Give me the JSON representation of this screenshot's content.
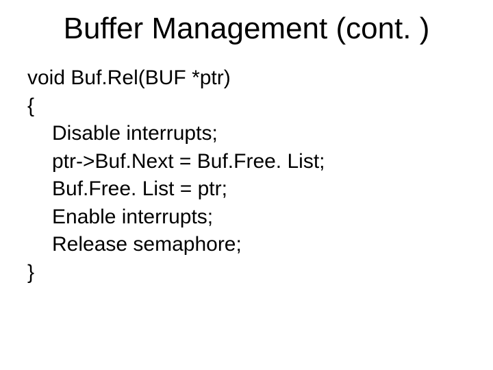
{
  "title": "Buffer Management (cont. )",
  "code": {
    "l0": "void Buf.Rel(BUF *ptr)",
    "l1": "{",
    "l2": "Disable interrupts;",
    "l3": "ptr->Buf.Next = Buf.Free. List;",
    "l4": "Buf.Free. List = ptr;",
    "l5": "Enable interrupts;",
    "l6": "Release semaphore;",
    "l7": "}"
  }
}
